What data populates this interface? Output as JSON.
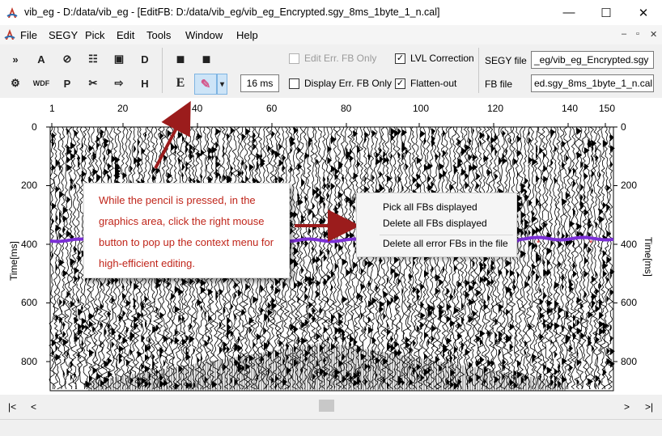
{
  "window": {
    "title": "vib_eg - D:/data/vib_eg - [EditFB: D:/data/vib_eg/vib_eg_Encrypted.sgy_8ms_1byte_1_n.cal]",
    "minimize_glyph": "—",
    "maximize_glyph": "☐",
    "close_glyph": "✕"
  },
  "menu": {
    "items": [
      "File",
      "SEGY",
      "Pick",
      "Edit",
      "Tools",
      "Window",
      "Help"
    ],
    "mdi": [
      "–",
      "▫",
      "✕"
    ]
  },
  "toolbar": {
    "icons_row1": [
      "fast-forward-icon",
      "triangle-a-icon",
      "lock-icon",
      "grid-icon",
      "camera-icon",
      "disk-d-icon"
    ],
    "icons_row2": [
      "gear-icon",
      "wdf-icon",
      "p-icon",
      "scissors-icon",
      "arrow-right-icon",
      "h-arrow-icon"
    ],
    "icon_glyphs_row1": [
      "»",
      "A",
      "⊘",
      "☷",
      "▣",
      "D"
    ],
    "icon_glyphs_row2": [
      "⚙",
      "WDF",
      "P",
      "✂",
      "⇨",
      "H"
    ],
    "save_glyph": "■",
    "e_glyph": "E",
    "pencil_glyph": "✎",
    "dropdown_glyph": "▾",
    "interval_value": "16 ms",
    "edit_err_fb_only": "Edit Err. FB Only",
    "display_err_fb_only": "Display Err. FB Only",
    "lvl_correction": "LVL Correction",
    "flatten_out": "Flatten-out",
    "check_glyph": "✓",
    "segy_file_label": "SEGY file",
    "segy_file_value": "_eg/vib_eg_Encrypted.sgy",
    "fb_file_label": "FB file",
    "fb_file_value": "ed.sgy_8ms_1byte_1_n.cal"
  },
  "plot": {
    "x_ticks": [
      "1",
      "20",
      "40",
      "60",
      "80",
      "100",
      "120",
      "140",
      "150"
    ],
    "y_ticks": [
      "0",
      "200",
      "400",
      "600",
      "800"
    ],
    "y_label": "Time[ms]",
    "accent_purple": "#7b2fd6"
  },
  "annotation": {
    "text": "While the pencil is pressed, in the graphics area, click the right mouse button to pop up the context menu for high-efficient editing.",
    "color": "#c0261b"
  },
  "context_menu": {
    "items": [
      "Pick all FBs displayed",
      "Delete all FBs displayed",
      "Delete all error FBs in the file"
    ]
  },
  "scrollbar": {
    "home": "|<",
    "left": "<",
    "right": ">",
    "end": ">|"
  }
}
